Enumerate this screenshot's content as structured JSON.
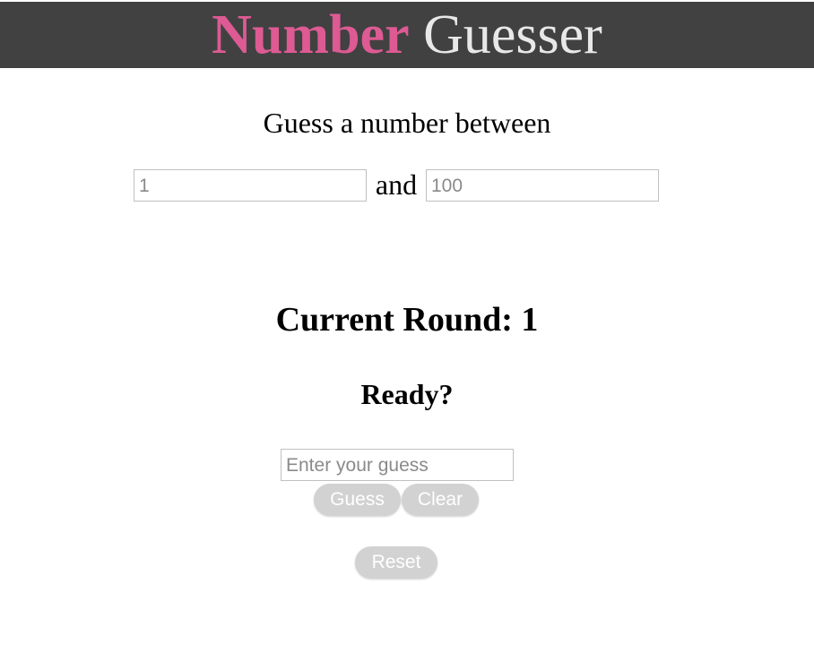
{
  "header": {
    "title_part1": "Number",
    "title_part2": "Guesser",
    "background_color": "#414141",
    "accent_color": "#dd5a93"
  },
  "range": {
    "prompt": "Guess a number between",
    "min_placeholder": "1",
    "conjunction": "and",
    "max_placeholder": "100"
  },
  "game": {
    "round_label": "Current Round: 1",
    "status": "Ready?",
    "guess_placeholder": "Enter your guess"
  },
  "buttons": {
    "guess_label": "Guess",
    "clear_label": "Clear",
    "reset_label": "Reset",
    "disabled_color": "#d2d2d2"
  }
}
